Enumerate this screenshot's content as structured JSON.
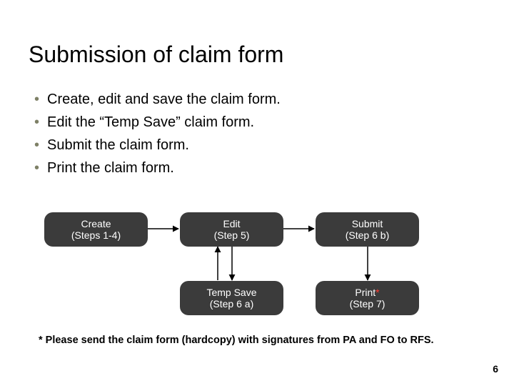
{
  "title": "Submission of claim form",
  "bullets": [
    "Create, edit and save the claim form.",
    "Edit the “Temp Save” claim form.",
    "Submit the claim form.",
    "Print the claim form."
  ],
  "nodes": {
    "create": {
      "line1": "Create",
      "line2": "(Steps 1-4)"
    },
    "edit": {
      "line1": "Edit",
      "line2": "(Step 5)"
    },
    "submit": {
      "line1": "Submit",
      "line2": "(Step 6 b)"
    },
    "tempsave": {
      "line1": "Temp Save",
      "line2": "(Step 6 a)"
    },
    "print": {
      "line1": "Print",
      "star": "*",
      "line2": "(Step 7)"
    }
  },
  "footnote": "* Please send the claim form (hardcopy) with signatures from PA and FO to RFS.",
  "pagenum": "6"
}
